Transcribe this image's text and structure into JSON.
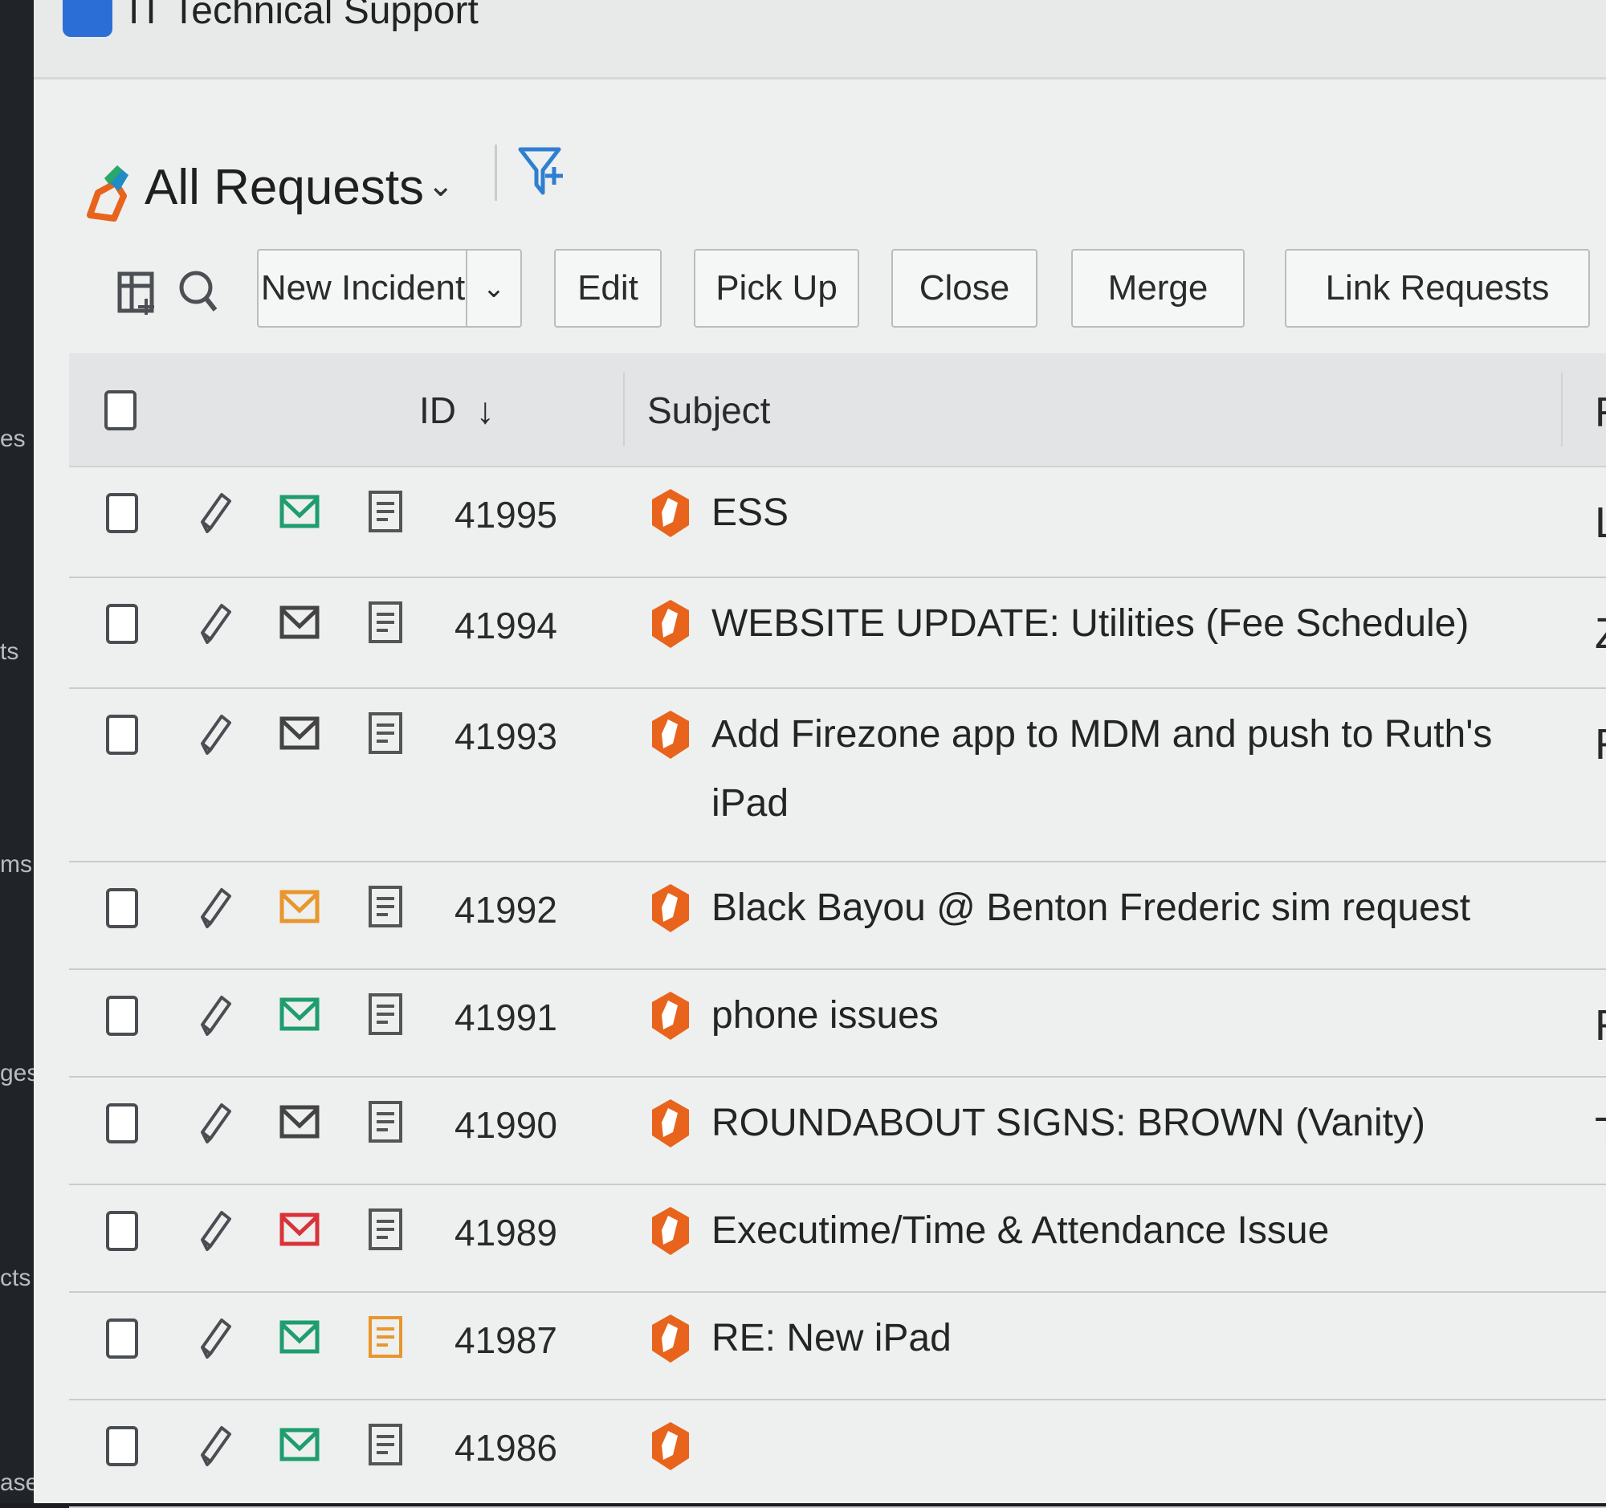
{
  "app": {
    "title": "IT Technical Support"
  },
  "sidebar": {
    "fragments": [
      {
        "text": "es"
      },
      {
        "text": "ts"
      },
      {
        "text": "ms"
      },
      {
        "text": "ges"
      },
      {
        "text": "cts"
      },
      {
        "text": "ases"
      }
    ]
  },
  "view": {
    "title": "All Requests"
  },
  "toolbar": {
    "new_incident": "New Incident",
    "edit": "Edit",
    "pick_up": "Pick Up",
    "close": "Close",
    "merge": "Merge",
    "link_requests": "Link Requests"
  },
  "table": {
    "columns": {
      "id": "ID",
      "subject": "Subject",
      "requester": "Re"
    },
    "sort_indicator": "↓",
    "rows": [
      {
        "id": "41995",
        "subject": "ESS",
        "requester": "Lu",
        "mail_color": "#1f9d6e",
        "note_color": "#555"
      },
      {
        "id": "41994",
        "subject": "WEBSITE UPDATE: Utilities (Fee Schedule)",
        "requester": "Zla",
        "mail_color": "#444",
        "note_color": "#555"
      },
      {
        "id": "41993",
        "subject": "Add Firezone app to MDM and push to Ruth's iPad",
        "requester": "Ru",
        "mail_color": "#444",
        "note_color": "#555"
      },
      {
        "id": "41992",
        "subject": "Black Bayou @ Benton Frederic sim request",
        "requester": "",
        "mail_color": "#e8962d",
        "note_color": "#555"
      },
      {
        "id": "41991",
        "subject": "phone issues",
        "requester": "Ry",
        "mail_color": "#1f9d6e",
        "note_color": "#555"
      },
      {
        "id": "41990",
        "subject": "ROUNDABOUT SIGNS: BROWN (Vanity)",
        "requester": "To",
        "mail_color": "#444",
        "note_color": "#555"
      },
      {
        "id": "41989",
        "subject": "Executime/Time & Attendance Issue",
        "requester": "",
        "mail_color": "#d9333a",
        "note_color": "#555"
      },
      {
        "id": "41987",
        "subject": "RE: New iPad",
        "requester": "",
        "mail_color": "#1f9d6e",
        "note_color": "#e8962d"
      },
      {
        "id": "41986",
        "subject": "",
        "requester": "",
        "mail_color": "#1f9d6e",
        "note_color": "#555"
      }
    ]
  }
}
